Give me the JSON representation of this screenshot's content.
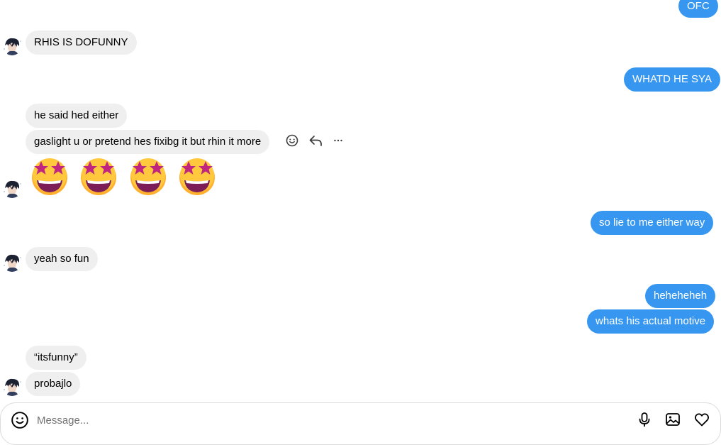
{
  "messages": {
    "m1": "OFC",
    "m2": "RHIS IS DOFUNNY",
    "m3": "WHATD HE SYA",
    "m4": "he said hed either",
    "m5": "gaslight u or pretend hes fixibg it but rhin it more",
    "m6": "so lie to me either way",
    "m7": "yeah so fun",
    "m8": "heheheheh",
    "m9": "whats his actual motive",
    "m10": "“itsfunny”",
    "m11": "probajlo"
  },
  "emoji_reaction": {
    "icon": "star-struck-emoji",
    "count": 4
  },
  "message_actions": [
    "react-icon",
    "reply-icon",
    "more-options-icon"
  ],
  "composer": {
    "placeholder": "Message...",
    "icons": [
      "emoji-icon",
      "microphone-icon",
      "image-icon",
      "heart-icon"
    ]
  },
  "colors": {
    "outgoing_bubble": "#3797f0",
    "incoming_bubble": "#efefef",
    "emoji_face": "#ffb02e",
    "emoji_star": "#c0267f"
  }
}
